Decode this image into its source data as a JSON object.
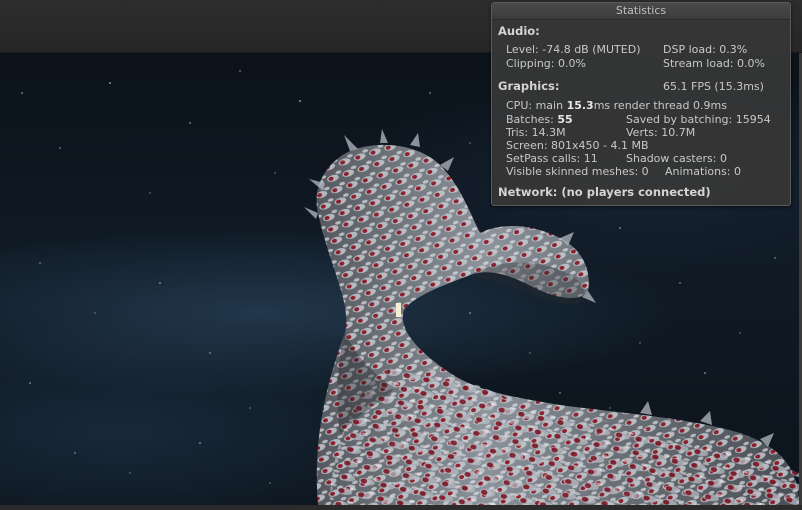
{
  "stats": {
    "title": "Statistics",
    "audio": {
      "header": "Audio:",
      "level": "Level: -74.8 dB (MUTED)",
      "dsp_load": "DSP load: 0.3%",
      "clipping": "Clipping: 0.0%",
      "stream_load": "Stream load: 0.0%"
    },
    "graphics": {
      "header": "Graphics:",
      "fps": "65.1 FPS (15.3ms)",
      "cpu_prefix": "CPU: main ",
      "cpu_main": "15.3",
      "cpu_suffix": "ms  render thread 0.9ms",
      "batches_prefix": "Batches: ",
      "batches": "55",
      "saved_by_batching": "Saved by batching: 15954",
      "tris": "Tris: 14.3M",
      "verts": "Verts: 10.7M",
      "screen": "Screen: 801x450 - 4.1 MB",
      "setpass": "SetPass calls: 11",
      "shadow_casters": "Shadow casters: 0",
      "visible_skinned": "Visible skinned meshes: 0",
      "animations": "Animations: 0"
    },
    "network": {
      "header": "Network: (no players connected)"
    }
  },
  "scene": {
    "icons": [
      "starfield",
      "creature-mesh",
      "light-marker"
    ],
    "colors": {
      "sky": "#0f1923",
      "mesh_silver": "#9aa0a8",
      "mesh_red": "#8e1c2a"
    }
  }
}
